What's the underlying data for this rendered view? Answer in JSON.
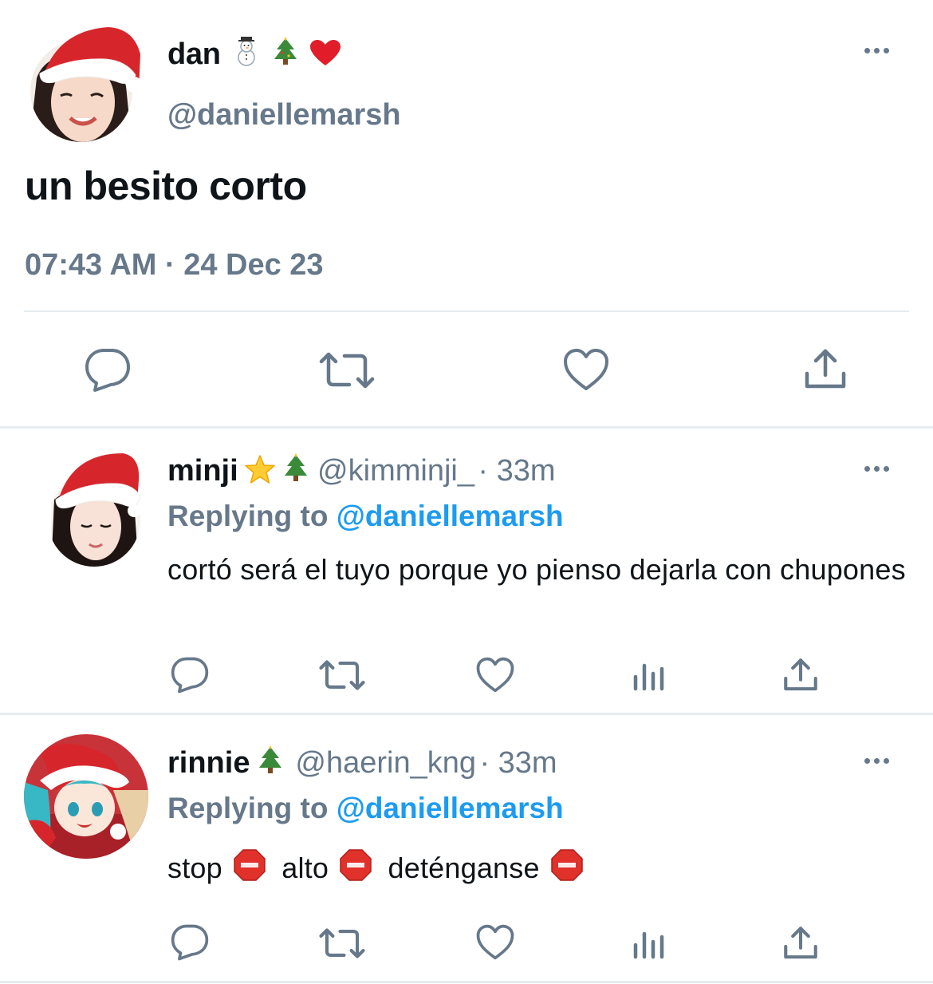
{
  "main_tweet": {
    "display_name": "dan",
    "name_emojis": [
      "snowman-emoji",
      "christmas-tree-emoji",
      "red-heart-emoji"
    ],
    "handle": "@daniellemarsh",
    "text": "un besito corto",
    "timestamp": "07:43 AM · 24 Dec 23",
    "actions": [
      "reply",
      "retweet",
      "like",
      "share"
    ]
  },
  "replies": [
    {
      "display_name": "minji",
      "name_emojis": [
        "star-emoji",
        "christmas-tree-emoji"
      ],
      "handle": "@kimminji_",
      "time": "· 33m",
      "replying_prefix": "Replying to",
      "replying_to": "@daniellemarsh",
      "text": "cortó será el tuyo porque yo pienso dejarla con chupones"
    },
    {
      "display_name": "rinnie",
      "name_emojis": [
        "christmas-tree-emoji"
      ],
      "handle": "@haerin_kng",
      "time": "· 33m",
      "replying_prefix": "Replying to",
      "replying_to": "@daniellemarsh",
      "text_parts": [
        "stop",
        "alto",
        "deténganse"
      ],
      "text_emoji": "stop-sign-emoji"
    }
  ],
  "colors": {
    "text": "#0f1419",
    "secondary": "#66788a",
    "link": "#1d9bf0",
    "divider": "#e6ecf0"
  }
}
